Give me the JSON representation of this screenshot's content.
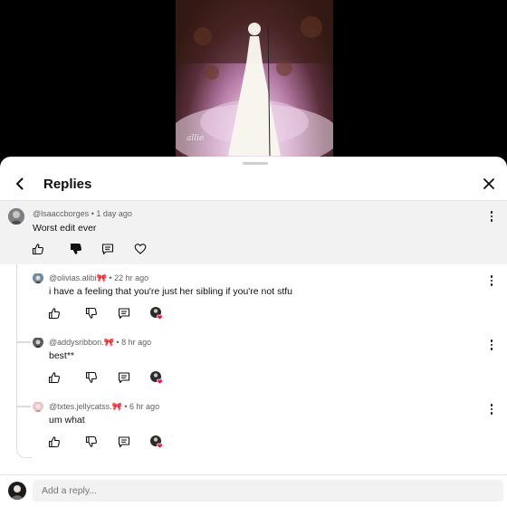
{
  "header": {
    "title": "Replies"
  },
  "parent_comment": {
    "author": "@lsaaccborges",
    "time": "1 day ago",
    "text": "Worst edit ever"
  },
  "replies": [
    {
      "author": "@olivias.alibi🎀",
      "time": "22 hr ago",
      "text": "i have a feeling that you're just her sibling if you're not stfu"
    },
    {
      "author": "@addysribbon.🎀",
      "time": "8 hr ago",
      "text": "best**"
    },
    {
      "author": "@txtes.jellycatss.🎀",
      "time": "6 hr ago",
      "text": "um what"
    }
  ],
  "meta_separator": "•",
  "reply_box": {
    "placeholder": "Add a reply..."
  },
  "video": {
    "watermark": "allie"
  },
  "colors": {
    "accent_red": "#ff0033",
    "parent_bg": "#f2f2f2",
    "text_primary": "#0f0f0f",
    "text_secondary": "#606060"
  }
}
